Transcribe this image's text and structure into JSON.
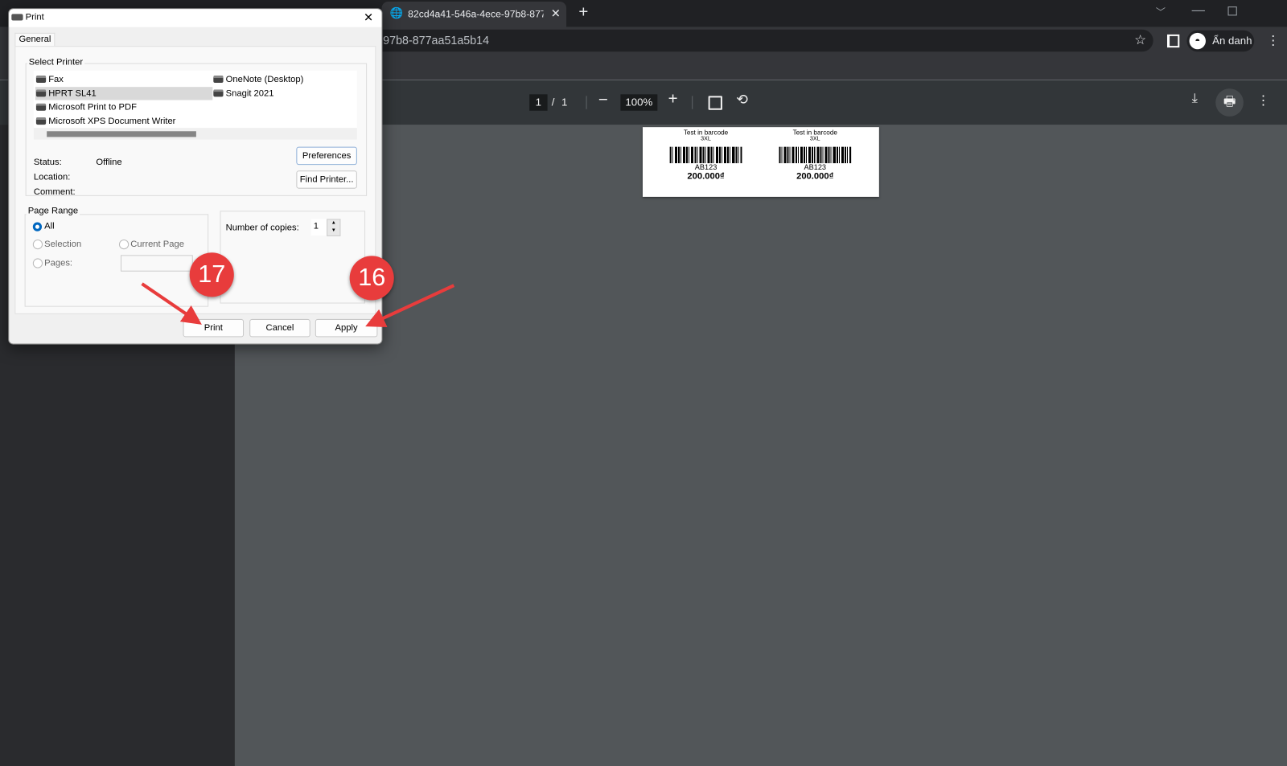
{
  "browser": {
    "tab_title": "82cd4a41-546a-4ece-97b8-877a",
    "url_fragment": "-97b8-877aa51a5b14",
    "profile_label": "Ẩn danh"
  },
  "pdf_toolbar": {
    "current_page": "1",
    "page_sep": "/",
    "total_pages": "1",
    "zoom": "100%"
  },
  "pdf_content": {
    "labels": [
      {
        "title": "Test in barcode",
        "size": "3XL",
        "code": "AB123",
        "price": "200.000₫"
      },
      {
        "title": "Test in barcode",
        "size": "3XL",
        "code": "AB123",
        "price": "200.000₫"
      }
    ]
  },
  "dialog": {
    "title": "Print",
    "tab": "General",
    "select_printer_label": "Select Printer",
    "printers": [
      {
        "name": "Fax"
      },
      {
        "name": "HPRT SL41",
        "selected": true
      },
      {
        "name": "Microsoft Print to PDF"
      },
      {
        "name": "Microsoft XPS Document Writer"
      },
      {
        "name": "OneNote (Desktop)"
      },
      {
        "name": "Snagit 2021"
      }
    ],
    "status_label": "Status:",
    "status_value": "Offline",
    "location_label": "Location:",
    "comment_label": "Comment:",
    "preferences": "Preferences",
    "find_printer": "Find Printer...",
    "page_range_label": "Page Range",
    "range_all": "All",
    "range_selection": "Selection",
    "range_current": "Current Page",
    "range_pages": "Pages:",
    "copies_label": "Number of copies:",
    "copies_value": "1",
    "print": "Print",
    "cancel": "Cancel",
    "apply": "Apply"
  },
  "annotations": {
    "step_print": "17",
    "step_apply": "16"
  },
  "colors": {
    "badge": "#e83c3c",
    "accent": "#0067c0"
  }
}
